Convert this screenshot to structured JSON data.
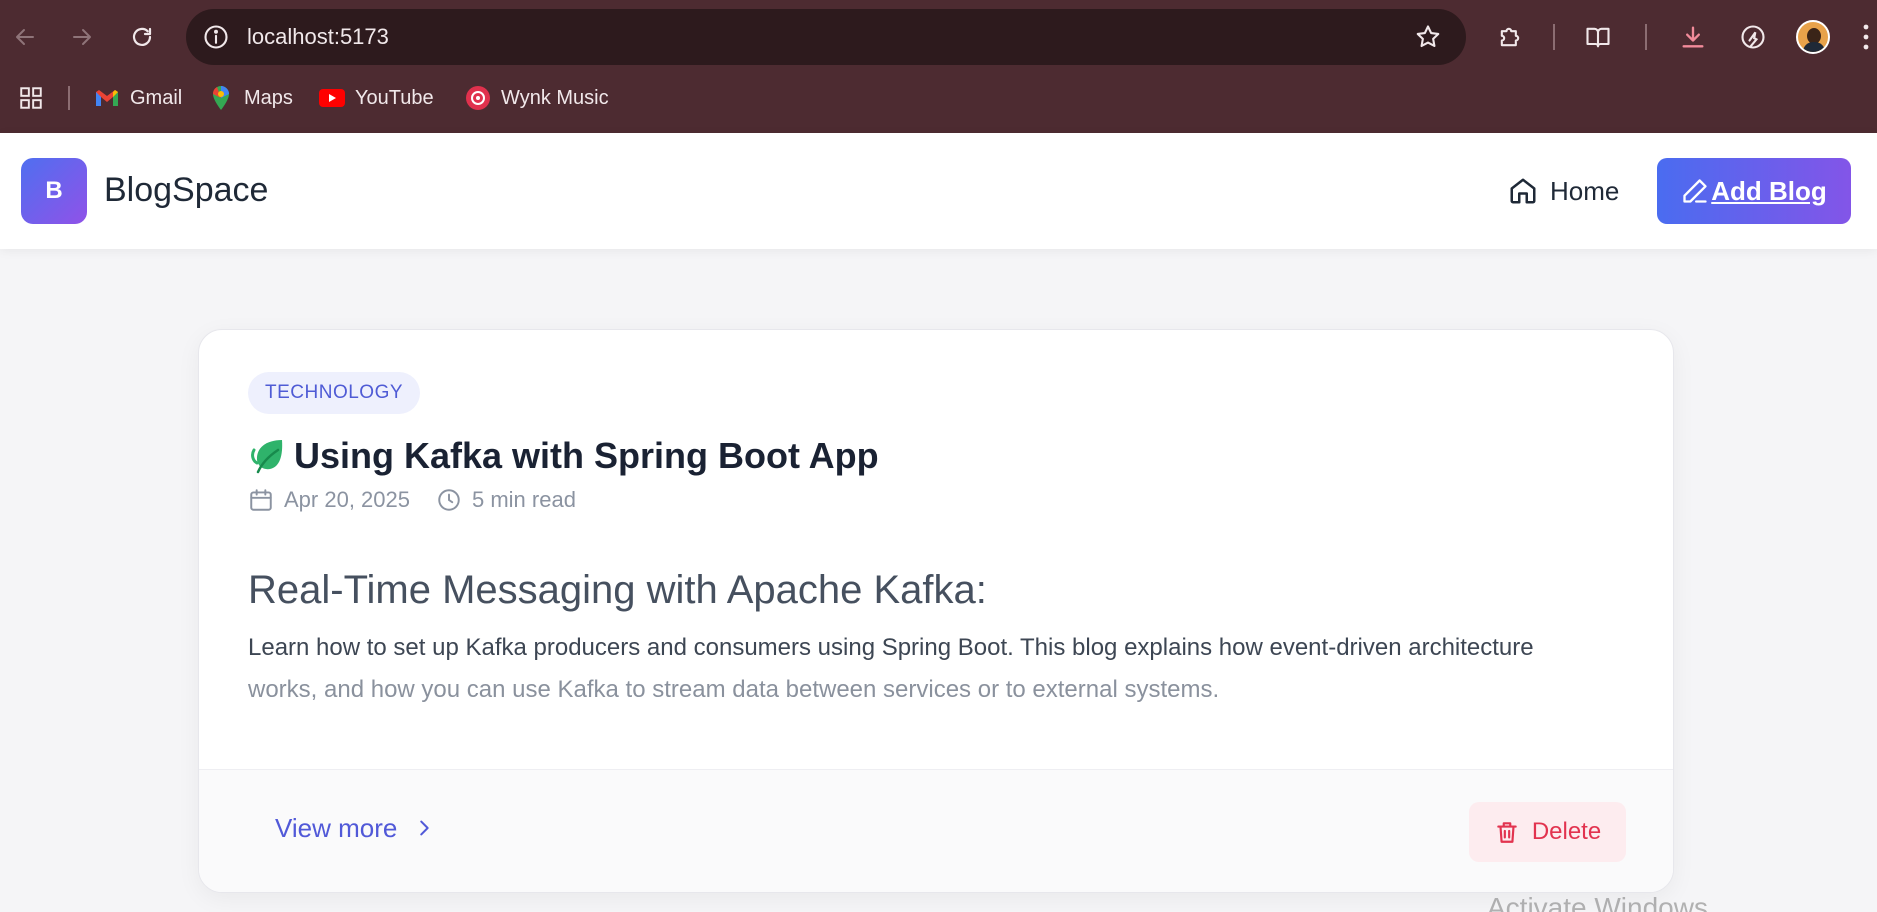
{
  "browser": {
    "url": "localhost:5173",
    "bookmarks": [
      {
        "label": "Gmail",
        "icon": "gmail-icon"
      },
      {
        "label": "Maps",
        "icon": "maps-icon"
      },
      {
        "label": "YouTube",
        "icon": "youtube-icon"
      },
      {
        "label": "Wynk Music",
        "icon": "wynk-music-icon"
      }
    ],
    "colors": {
      "chrome": "#4d2b31",
      "omnibox": "#2d1a1d"
    }
  },
  "app": {
    "logo_letter": "B",
    "brand": "BlogSpace",
    "nav": {
      "home": "Home",
      "add_blog": "Add Blog"
    },
    "colors": {
      "accent_start": "#4a6cf0",
      "accent_end": "#8355e8"
    }
  },
  "post": {
    "category": "TECHNOLOGY",
    "title_emoji": "leaf-icon",
    "title": "Using Kafka with Spring Boot App",
    "date": "Apr 20, 2025",
    "read_time": "5 min read",
    "subheading": "Real-Time Messaging with Apache Kafka:",
    "excerpt_line1": "Learn how to set up Kafka producers and consumers using Spring Boot. This blog explains how event-driven architecture",
    "excerpt_line2": "works, and how you can use Kafka to stream data between services or to external systems.",
    "view_more": "View more",
    "delete": "Delete"
  },
  "watermark": "Activate Windows"
}
